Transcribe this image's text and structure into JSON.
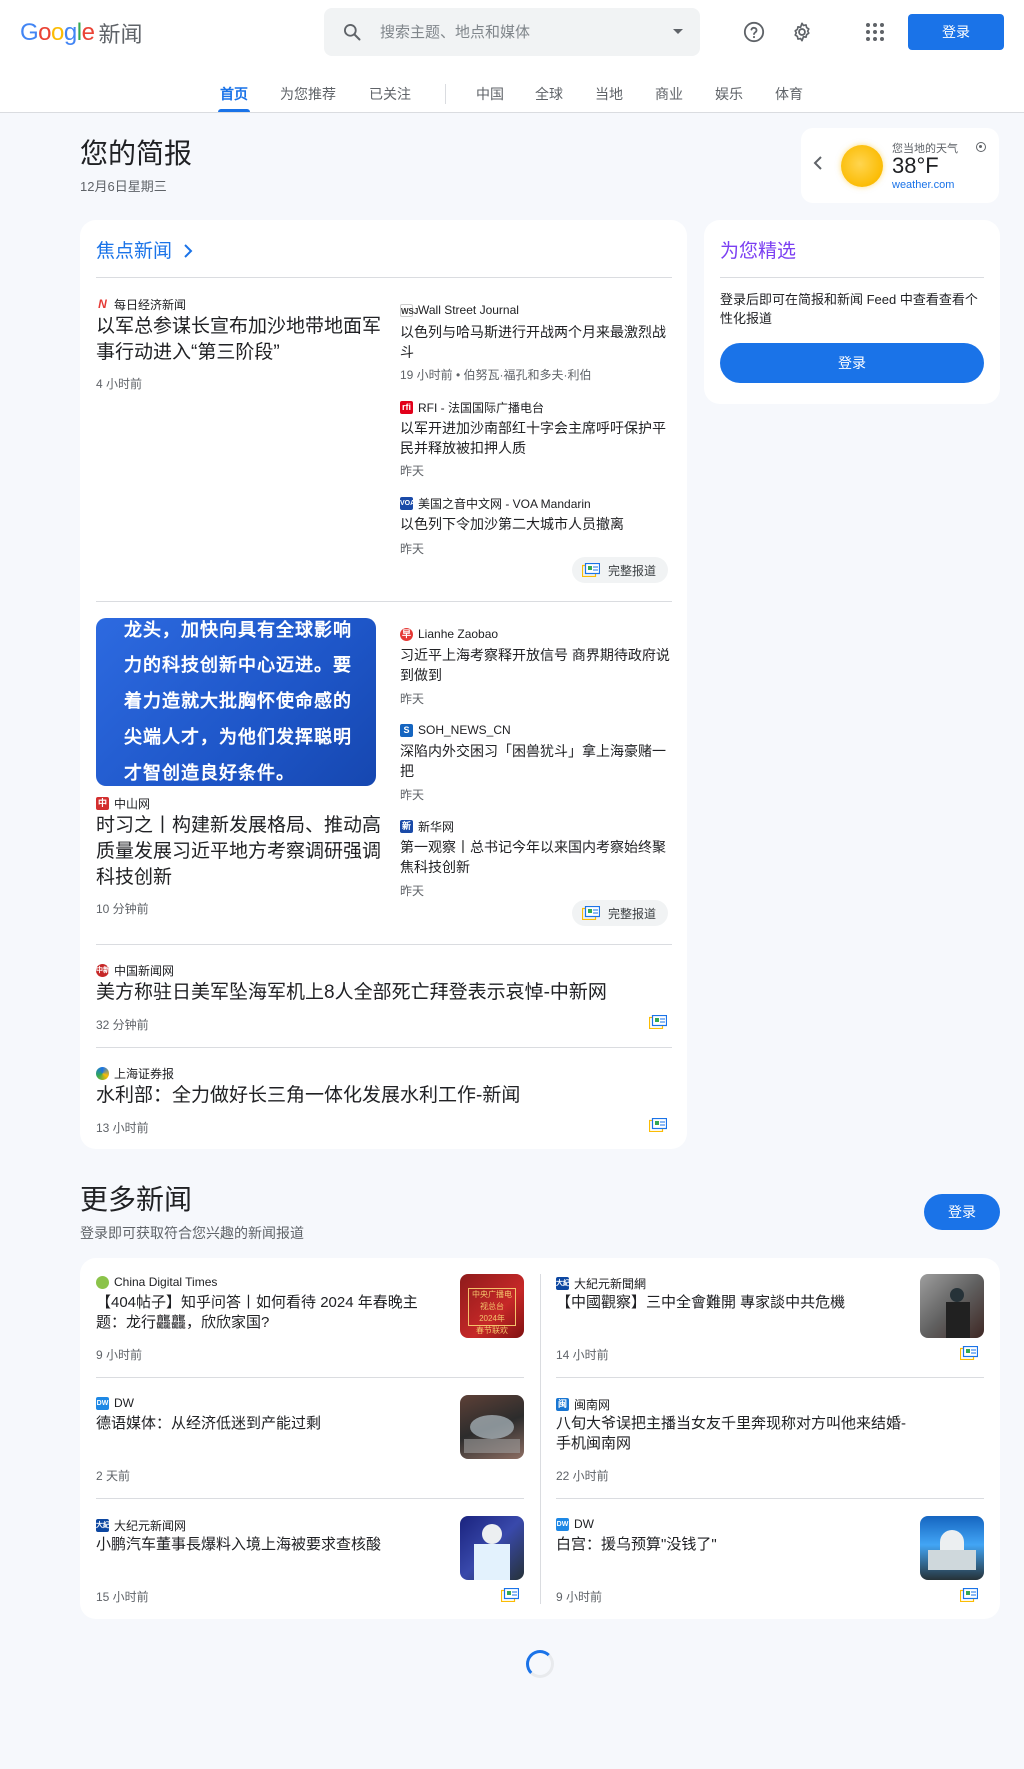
{
  "header": {
    "logo_google": "Google",
    "logo_news": "新闻",
    "search_placeholder": "搜索主题、地点和媒体",
    "signin": "登录"
  },
  "nav": {
    "tabs": [
      {
        "label": "首页",
        "active": true
      },
      {
        "label": "为您推荐"
      },
      {
        "label": "已关注"
      },
      {
        "label": "中国"
      },
      {
        "label": "全球"
      },
      {
        "label": "当地"
      },
      {
        "label": "商业"
      },
      {
        "label": "娱乐"
      },
      {
        "label": "体育"
      }
    ]
  },
  "briefing": {
    "title": "您的简报",
    "date": "12月6日星期三"
  },
  "weather": {
    "label": "您当地的天气",
    "temp": "38°F",
    "source": "weather.com"
  },
  "top_stories": {
    "title": "焦点新闻",
    "full_coverage": "完整报道",
    "cluster1": {
      "main": {
        "source": "每日经济新闻",
        "headline": "以军总参谋长宣布加沙地带地面军事行动进入“第三阶段”",
        "time": "4 小时前"
      },
      "side": [
        {
          "source": "Wall Street Journal",
          "headline": "以色列与哈马斯进行开战两个月来最激烈战斗",
          "time": "19 小时前 • 伯努瓦·福孔和多夫·利伯"
        },
        {
          "source": "RFI - 法国国际广播电台",
          "headline": "以军开进加沙南部红十字会主席呼吁保护平民并释放被扣押人质",
          "time": "昨天"
        },
        {
          "source": "美国之音中文网 - VOA Mandarin",
          "headline": "以色列下令加沙第二大城市人员撤离",
          "time": "昨天"
        }
      ]
    },
    "cluster2": {
      "image_lines": [
        "龙头，加快向具有全球影响",
        "力的科技创新中心迈进。要",
        "着力造就大批胸怀使命感的",
        "尖端人才，为他们发挥聪明",
        "才智创造良好条件。"
      ],
      "main": {
        "source": "中山网",
        "headline": "时习之丨构建新发展格局、推动高质量发展习近平地方考察调研强调科技创新",
        "time": "10 分钟前"
      },
      "side": [
        {
          "source": "Lianhe Zaobao",
          "headline": "习近平上海考察释开放信号 商界期待政府说到做到",
          "time": "昨天"
        },
        {
          "source": "SOH_NEWS_CN",
          "headline": "深陷内外交困习「困兽犹斗」拿上海豪赌一把",
          "time": "昨天"
        },
        {
          "source": "新华网",
          "headline": "第一观察丨总书记今年以来国内考察始终聚焦科技创新",
          "time": "昨天"
        }
      ]
    },
    "single": [
      {
        "source": "中国新闻网",
        "headline": "美方称驻日美军坠海军机上8人全部死亡拜登表示哀悼-中新网",
        "time": "32 分钟前"
      },
      {
        "source": "上海证券报",
        "headline": "水利部：全力做好长三角一体化发展水利工作-新闻",
        "time": "13 小时前"
      }
    ]
  },
  "picks": {
    "title": "为您精选",
    "text": "登录后即可在简报和新闻 Feed 中查看查看个性化报道",
    "button": "登录"
  },
  "more": {
    "title": "更多新闻",
    "subtitle": "登录即可获取符合您兴趣的新闻报道",
    "button": "登录",
    "left": [
      {
        "source": "China Digital Times",
        "headline": "【404帖子】知乎问答丨如何看待 2024 年春晚主题：龙行龘龘，欣欣家国?",
        "time": "9 小时前"
      },
      {
        "source": "DW",
        "headline": "德语媒体：从经济低迷到产能过剩",
        "time": "2 天前"
      },
      {
        "source": "大纪元新闻网",
        "headline": "小鹏汽车董事長爆料入境上海被要求查核酸",
        "time": "15 小时前"
      }
    ],
    "right": [
      {
        "source": "大紀元新聞網",
        "headline": "【中國觀察】三中全會難開 專家談中共危機",
        "time": "14 小时前"
      },
      {
        "source": "闽南网",
        "headline": "八旬大爷误把主播当女友千里奔现称对方叫他来结婚-手机闽南网",
        "time": "22 小时前"
      },
      {
        "source": "DW",
        "headline": "白宫：援乌预算\"没钱了\"",
        "time": "9 小时前"
      }
    ],
    "thumb1_text": "中央广播电视总台\n2024年\n春节联欢"
  },
  "colors": {
    "accent": "#1a73e8",
    "picks": "#7b3ff2"
  }
}
